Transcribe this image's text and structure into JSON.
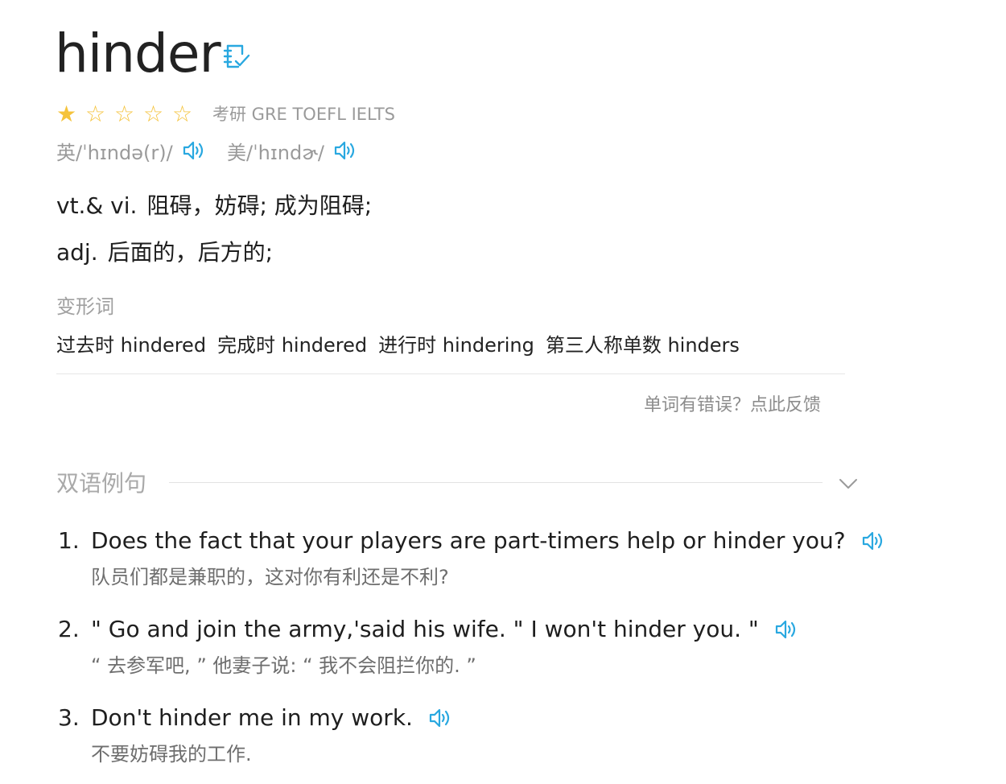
{
  "entry": {
    "word": "hinder",
    "stars_filled": 1,
    "stars_total": 5,
    "exam_tags": "考研 GRE TOEFL IELTS",
    "phonetics": {
      "uk": "英/ˈhɪndə(r)/",
      "us": "美/ˈhɪndɚ/"
    },
    "definitions": [
      {
        "pos": "vt.& vi.",
        "meaning": "阻碍，妨碍; 成为阻碍;"
      },
      {
        "pos": "adj.",
        "meaning": "后面的，后方的;"
      }
    ],
    "forms_title": "变形词",
    "forms": [
      "过去时 hindered",
      "完成时 hindered",
      "进行时 hindering",
      "第三人称单数 hinders"
    ],
    "report_link": "单词有错误？点此反馈"
  },
  "examples": {
    "title": "双语例句",
    "items": [
      {
        "num": "1.",
        "en": "Does the fact that your players are part-timers help or hinder you?",
        "zh": "队员们都是兼职的，这对你有利还是不利?"
      },
      {
        "num": "2.",
        "en": "\" Go and join the army,'said his wife. \" I won't hinder you. \"",
        "zh": "“ 去参军吧, ” 他妻子说: “ 我不会阻拦你的. ”"
      },
      {
        "num": "3.",
        "en": "Don't hinder me in my work.",
        "zh": "不要妨碍我的工作."
      }
    ]
  },
  "colors": {
    "accent": "#29a8e0",
    "star": "#f5c33b",
    "muted": "#9a9a9a"
  },
  "icons": {
    "wordbook": "notebook-check-icon",
    "audio": "speaker-icon",
    "collapse": "chevron-down-icon",
    "star_full": "star-filled-icon",
    "star_empty": "star-outline-icon"
  }
}
